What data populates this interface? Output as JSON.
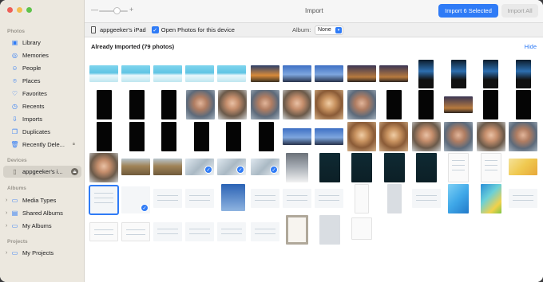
{
  "window": {
    "title": "Import"
  },
  "toolbar": {
    "zoom_minus": "—",
    "zoom_plus": "+",
    "import_selected_label": "Import 6 Selected",
    "import_all_label": "Import All"
  },
  "device_bar": {
    "device_name": "appgeeker's iPad",
    "open_photos_label": "Open Photos for this device",
    "open_photos_checked": true,
    "album_label": "Album:",
    "album_value": "None"
  },
  "sidebar": {
    "photos_section": "Photos",
    "photos_items": [
      {
        "label": "Library",
        "icon": "photo-library-icon"
      },
      {
        "label": "Memories",
        "icon": "memories-icon"
      },
      {
        "label": "People",
        "icon": "people-icon"
      },
      {
        "label": "Places",
        "icon": "places-pin-icon"
      },
      {
        "label": "Favorites",
        "icon": "heart-icon"
      },
      {
        "label": "Recents",
        "icon": "clock-icon"
      },
      {
        "label": "Imports",
        "icon": "import-arrow-icon"
      },
      {
        "label": "Duplicates",
        "icon": "duplicates-icon"
      },
      {
        "label": "Recently Dele...",
        "icon": "trash-icon"
      }
    ],
    "devices_section": "Devices",
    "device_item": "appgeeker's i...",
    "albums_section": "Albums",
    "album_items": [
      {
        "label": "Media Types",
        "icon": "folder-icon"
      },
      {
        "label": "Shared Albums",
        "icon": "shared-album-icon"
      },
      {
        "label": "My Albums",
        "icon": "folder-icon"
      }
    ],
    "projects_section": "Projects",
    "project_items": [
      {
        "label": "My Projects",
        "icon": "folder-icon"
      }
    ]
  },
  "content": {
    "section_title": "Already Imported (79 photos)",
    "hide_label": "Hide"
  },
  "colors": {
    "accent": "#2f7bf6",
    "sidebar_bg": "#ece8df",
    "traffic_red": "#ee5f57",
    "traffic_yellow": "#f4bd4f",
    "traffic_green": "#5ec34b"
  }
}
